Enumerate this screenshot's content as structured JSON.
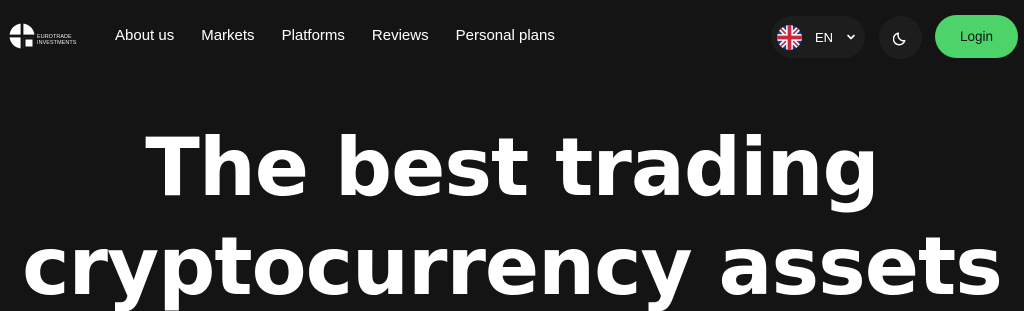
{
  "logo": {
    "line1": "EUROTRADE",
    "line2": "INVESTMENTS",
    "icon": "eurotrade-logo-icon"
  },
  "nav": {
    "items": [
      {
        "label": "About us"
      },
      {
        "label": "Markets"
      },
      {
        "label": "Platforms"
      },
      {
        "label": "Reviews"
      },
      {
        "label": "Personal plans"
      }
    ]
  },
  "language": {
    "code": "EN",
    "flag_icon": "uk-flag-icon",
    "dropdown_icon": "chevron-down-icon"
  },
  "theme_toggle": {
    "icon": "moon-icon"
  },
  "login": {
    "label": "Login",
    "color": "#4cd46a"
  },
  "hero": {
    "line1": "The best trading",
    "line2": "cryptocurrency assets"
  },
  "colors": {
    "background": "#151414",
    "text": "#ffffff",
    "accent": "#4cd46a"
  }
}
